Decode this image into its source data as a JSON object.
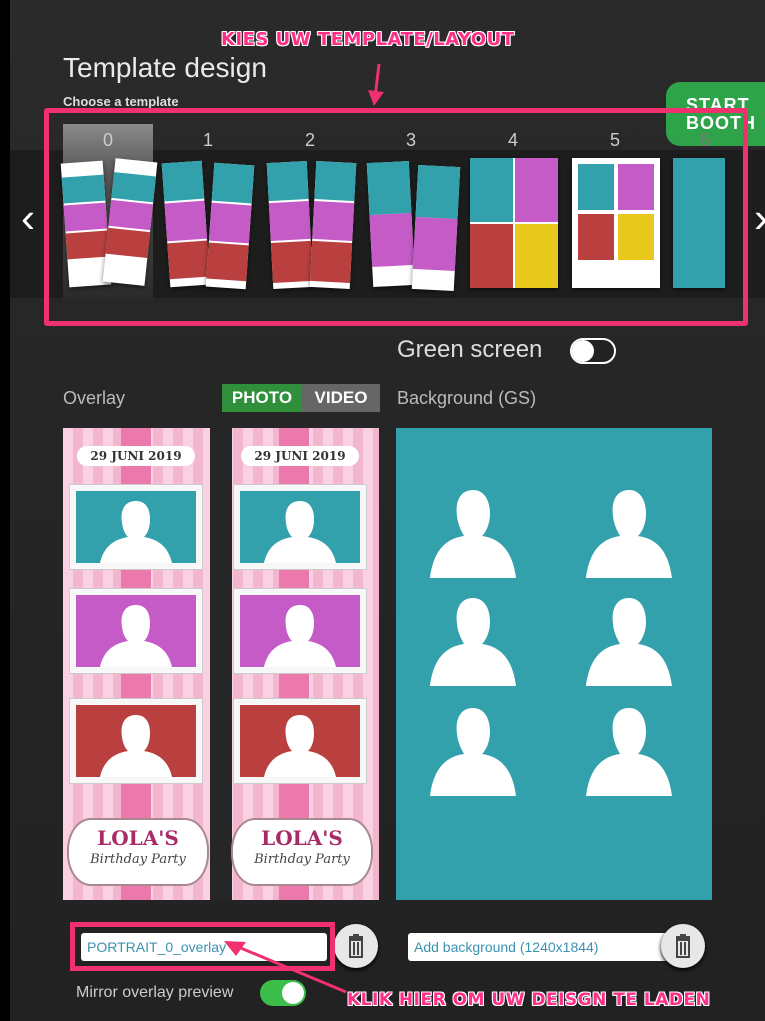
{
  "annotations": {
    "top_banner": "KIES UW TEMPLATE/LAYOUT",
    "bottom_banner": "KLIK HIER OM UW DEISGN TE LADEN"
  },
  "header": {
    "title": "Template design",
    "choose_label": "Choose a template",
    "start_button": [
      "START",
      "BOOTH"
    ]
  },
  "templates": {
    "selected_index": 0,
    "items": [
      {
        "label": "0"
      },
      {
        "label": "1"
      },
      {
        "label": "2"
      },
      {
        "label": "3"
      },
      {
        "label": "4"
      },
      {
        "label": "5"
      },
      {
        "label": "6"
      }
    ]
  },
  "green_screen": {
    "label": "Green screen",
    "enabled": false
  },
  "overlay": {
    "label": "Overlay",
    "mode_photo": "PHOTO",
    "mode_video": "VIDEO",
    "selected_mode": "PHOTO",
    "date_text": "29 JUNI 2019",
    "title_text": "LOLA'S",
    "subtitle_text": "Birthday Party",
    "file_value": "PORTRAIT_0_overlay",
    "mirror_label": "Mirror overlay preview",
    "mirror_enabled": true
  },
  "background": {
    "label": "Background (GS)",
    "placeholder": "Add background (1240x1844)"
  },
  "colors": {
    "teal": "#33a1ac",
    "magenta": "#c45bc6",
    "red": "#b9403f",
    "yellow": "#e8c91b",
    "annotation_pink": "#f0306f",
    "green": "#2fa34a"
  }
}
